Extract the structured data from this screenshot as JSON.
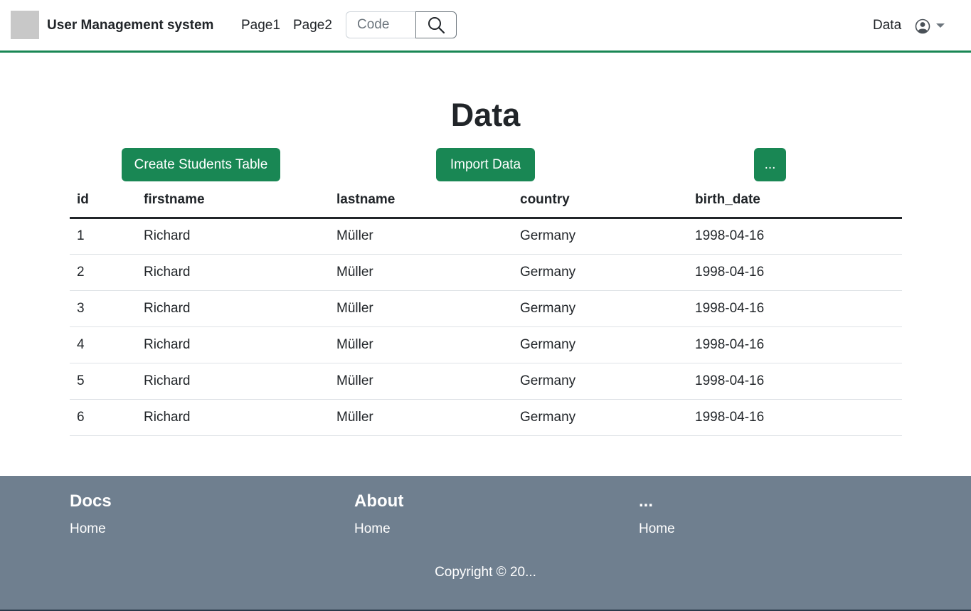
{
  "navbar": {
    "brand": "User Management system",
    "links": [
      "Page1",
      "Page2"
    ],
    "search_placeholder": "Code",
    "right_link": "Data"
  },
  "main": {
    "title": "Data",
    "buttons": {
      "create": "Create Students Table",
      "import": "Import Data",
      "more": "..."
    },
    "table": {
      "headers": [
        "id",
        "firstname",
        "lastname",
        "country",
        "birth_date"
      ],
      "rows": [
        [
          "1",
          "Richard",
          "Müller",
          "Germany",
          "1998-04-16"
        ],
        [
          "2",
          "Richard",
          "Müller",
          "Germany",
          "1998-04-16"
        ],
        [
          "3",
          "Richard",
          "Müller",
          "Germany",
          "1998-04-16"
        ],
        [
          "4",
          "Richard",
          "Müller",
          "Germany",
          "1998-04-16"
        ],
        [
          "5",
          "Richard",
          "Müller",
          "Germany",
          "1998-04-16"
        ],
        [
          "6",
          "Richard",
          "Müller",
          "Germany",
          "1998-04-16"
        ]
      ]
    }
  },
  "footer": {
    "columns": [
      {
        "title": "Docs",
        "link": "Home"
      },
      {
        "title": "About",
        "link": "Home"
      },
      {
        "title": "...",
        "link": "Home"
      }
    ],
    "copyright": "Copyright © 20..."
  },
  "colors": {
    "accent": "#198754",
    "footer_bg": "#6f7f8f"
  },
  "icons": {
    "search": "search-icon",
    "user": "user-circle-icon",
    "dropdown": "caret-down-icon"
  }
}
